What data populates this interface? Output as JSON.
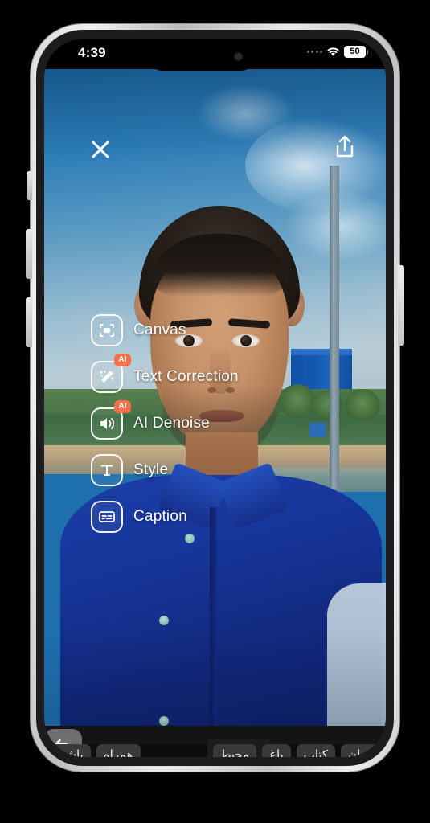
{
  "device": {
    "name": "smartphone-mockup",
    "frame_color": "#d4d4d4",
    "bezel_color": "#1c1c1e"
  },
  "status_bar": {
    "time": "4:39",
    "battery_level": "50",
    "wifi_icon": "wifi-icon",
    "signal_icon": "signal-dots-icon",
    "battery_icon": "battery-icon"
  },
  "header": {
    "close_icon": "close-icon",
    "close_label": "Close",
    "share_icon": "share-icon",
    "share_label": "Share"
  },
  "tool_menu": {
    "items": [
      {
        "label": "Canvas",
        "icon": "canvas-crop-icon",
        "badge": ""
      },
      {
        "label": "Text Correction",
        "icon": "magic-wand-icon",
        "badge": "AI"
      },
      {
        "label": "AI Denoise",
        "icon": "speaker-volume-icon",
        "badge": "AI"
      },
      {
        "label": "Style",
        "icon": "text-style-icon",
        "badge": ""
      },
      {
        "label": "Caption",
        "icon": "caption-icon",
        "badge": ""
      }
    ],
    "badge_color": "#f4714a",
    "label_color": "#ffffff"
  },
  "bottom_bar": {
    "undo_icon": "undo-arrow-icon",
    "undo_label": "Undo",
    "background": "#141414"
  },
  "keyboard_suggestions": {
    "left_group": [
      "باشید",
      "همراه"
    ],
    "right_group": [
      "تهران",
      "کتاب",
      "باغ",
      "محیط"
    ],
    "chip_background": "#3a3a3c",
    "chip_text_color": "#f2f2f2"
  },
  "photo": {
    "description": "selfie-photo",
    "sky_color": "#2b7cb8",
    "shirt_color": "#17359a",
    "building_color": "#1457b0"
  }
}
